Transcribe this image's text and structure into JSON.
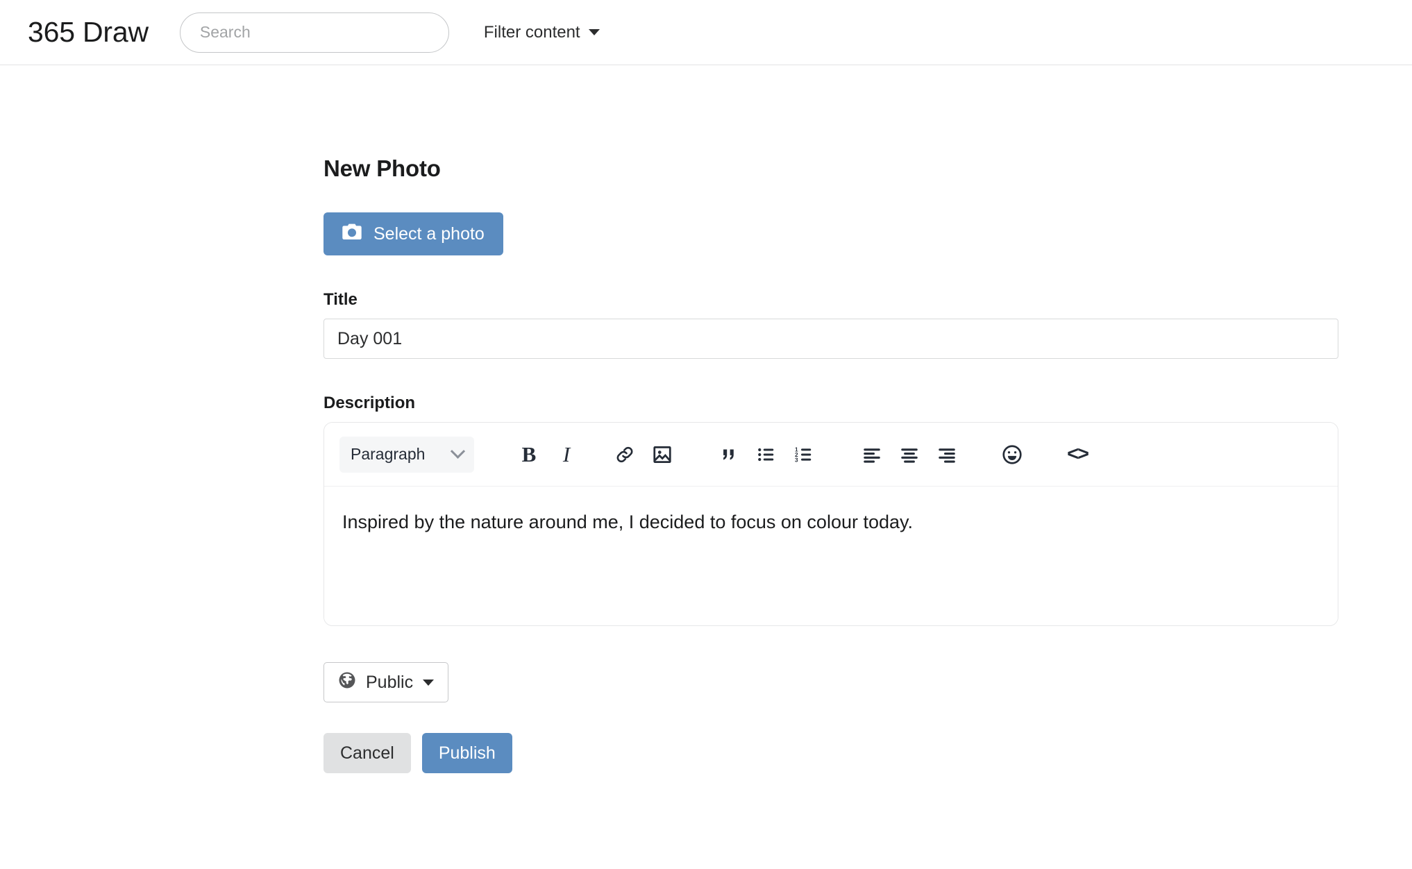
{
  "header": {
    "brand": "365 Draw",
    "search": {
      "value": "",
      "placeholder": "Search",
      "icon": "search-icon"
    },
    "filter": {
      "label": "Filter content",
      "icon": "chevron-down-icon"
    }
  },
  "main": {
    "page_title": "New Photo",
    "select_photo": {
      "label": "Select a photo",
      "icon": "camera-icon",
      "color": "#5b8cc0"
    },
    "title_field": {
      "label": "Title",
      "value": "Day 001",
      "placeholder": ""
    },
    "description_field": {
      "label": "Description",
      "value": "Inspired by the nature around me, I decided to focus on colour today."
    },
    "editor_toolbar": {
      "block_format": {
        "value": "Paragraph",
        "icon": "chevron-down-icon"
      },
      "buttons": [
        {
          "name": "bold-button",
          "label": "B",
          "icon": "bold-icon"
        },
        {
          "name": "italic-button",
          "label": "I",
          "icon": "italic-icon"
        },
        {
          "name": "link-button",
          "label": "",
          "icon": "link-icon"
        },
        {
          "name": "image-button",
          "label": "",
          "icon": "image-icon"
        },
        {
          "name": "blockquote-button",
          "label": "",
          "icon": "quote-icon"
        },
        {
          "name": "bullet-list-button",
          "label": "",
          "icon": "bullet-list-icon"
        },
        {
          "name": "numbered-list-button",
          "label": "",
          "icon": "numbered-list-icon"
        },
        {
          "name": "align-left-button",
          "label": "",
          "icon": "align-left-icon"
        },
        {
          "name": "align-center-button",
          "label": "",
          "icon": "align-center-icon"
        },
        {
          "name": "align-right-button",
          "label": "",
          "icon": "align-right-icon"
        },
        {
          "name": "emoji-button",
          "label": "",
          "icon": "smiley-icon"
        },
        {
          "name": "code-button",
          "label": "<>",
          "icon": "code-icon"
        }
      ]
    },
    "visibility": {
      "label": "Public",
      "icon": "globe-icon"
    },
    "cancel": {
      "label": "Cancel"
    },
    "publish": {
      "label": "Publish",
      "color": "#5b8cc0"
    }
  }
}
